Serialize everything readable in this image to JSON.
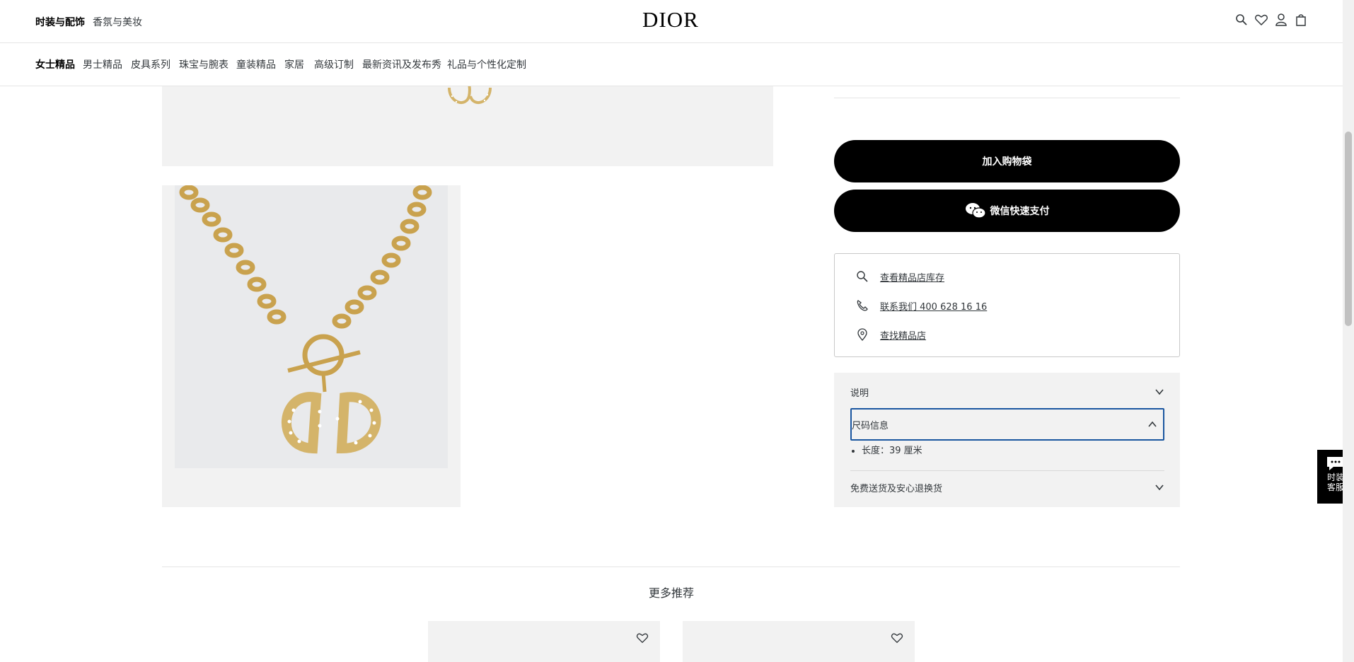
{
  "header": {
    "top_links": [
      "时装与配饰",
      "香氛与美妆"
    ],
    "logo": "DIOR",
    "icons": [
      "search-icon",
      "heart-icon",
      "user-icon",
      "bag-icon"
    ]
  },
  "nav": {
    "items": [
      "女士精品",
      "男士精品",
      "皮具系列",
      "珠宝与腕表",
      "童装精品",
      "家居",
      "高级订制",
      "最新资讯及发布秀",
      "礼品与个性化定制"
    ]
  },
  "product": {
    "add_to_bag": "加入购物袋",
    "wechat_pay": "微信快速支付"
  },
  "store": {
    "check_stock": "查看精品店库存",
    "contact": "联系我们 400 628 16 16",
    "find_store": "查找精品店"
  },
  "accordion": {
    "description": "说明",
    "size_info": "尺码信息",
    "size_detail": "长度：39 厘米",
    "shipping": "免费送货及安心退换货"
  },
  "recommend": {
    "title": "更多推荐"
  },
  "chat": {
    "line1": "时装",
    "line2": "客服"
  },
  "colors": {
    "accent": "#000000",
    "panel": "#f2f2f2",
    "focus": "#1a56a0",
    "gold": "#d4b46a"
  }
}
